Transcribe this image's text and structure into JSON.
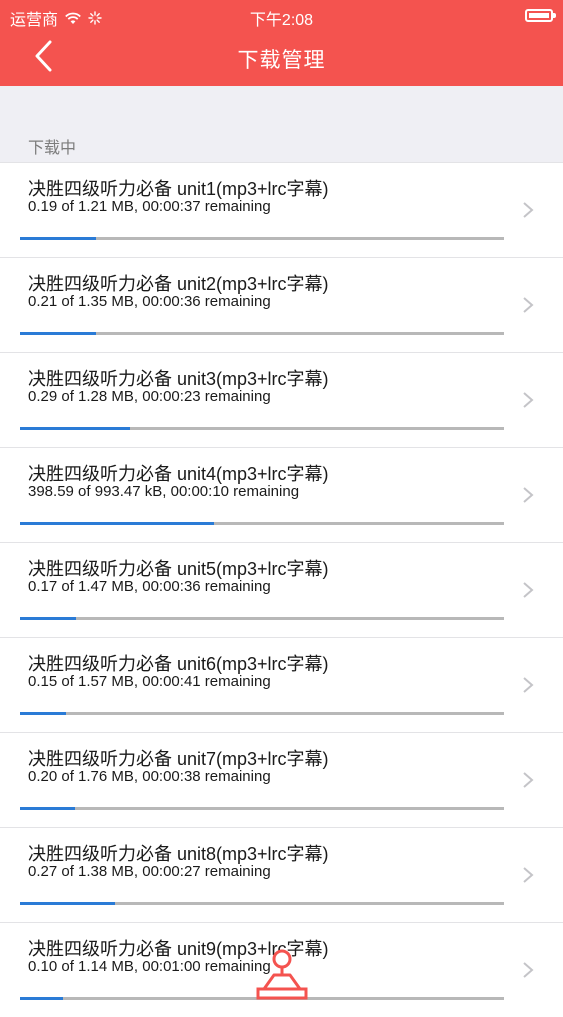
{
  "status_bar": {
    "carrier": "运营商",
    "time": "下午2:08"
  },
  "nav": {
    "title": "下载管理"
  },
  "section": {
    "label": "下载中"
  },
  "items": [
    {
      "title": "决胜四级听力必备 unit1(mp3+lrc字幕)",
      "status": "0.19 of 1.21 MB, 00:00:37 remaining",
      "progress": 0.157
    },
    {
      "title": "决胜四级听力必备 unit2(mp3+lrc字幕)",
      "status": "0.21 of 1.35 MB, 00:00:36 remaining",
      "progress": 0.156
    },
    {
      "title": "决胜四级听力必备 unit3(mp3+lrc字幕)",
      "status": "0.29 of 1.28 MB, 00:00:23 remaining",
      "progress": 0.227
    },
    {
      "title": "决胜四级听力必备 unit4(mp3+lrc字幕)",
      "status": "398.59 of 993.47 kB, 00:00:10 remaining",
      "progress": 0.401
    },
    {
      "title": "决胜四级听力必备 unit5(mp3+lrc字幕)",
      "status": "0.17 of 1.47 MB, 00:00:36 remaining",
      "progress": 0.116
    },
    {
      "title": "决胜四级听力必备 unit6(mp3+lrc字幕)",
      "status": "0.15 of 1.57 MB, 00:00:41 remaining",
      "progress": 0.096
    },
    {
      "title": "决胜四级听力必备 unit7(mp3+lrc字幕)",
      "status": "0.20 of 1.76 MB, 00:00:38 remaining",
      "progress": 0.114
    },
    {
      "title": "决胜四级听力必备 unit8(mp3+lrc字幕)",
      "status": "0.27 of 1.38 MB, 00:00:27 remaining",
      "progress": 0.196
    },
    {
      "title": "决胜四级听力必备 unit9(mp3+lrc字幕)",
      "status": "0.10 of 1.14 MB, 00:01:00 remaining",
      "progress": 0.088
    }
  ],
  "colors": {
    "header": "#f4534f",
    "progress": "#2a7bd6",
    "track": "#b8b8b8",
    "background": "#efeff4"
  }
}
